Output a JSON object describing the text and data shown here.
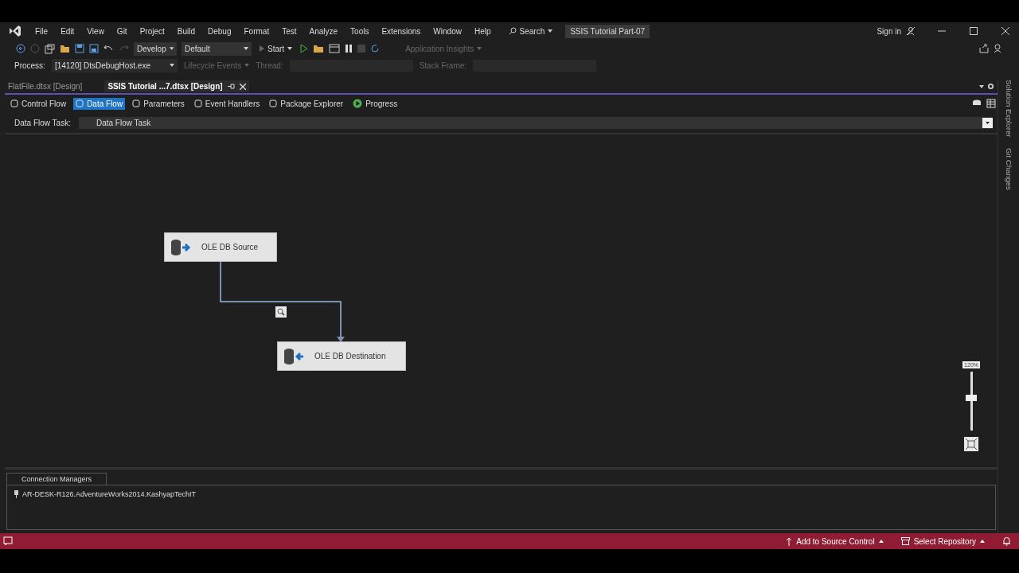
{
  "menu": {
    "items": [
      "File",
      "Edit",
      "View",
      "Git",
      "Project",
      "Build",
      "Debug",
      "Format",
      "Test",
      "Analyze",
      "Tools",
      "Extensions",
      "Window",
      "Help"
    ],
    "search": "Search",
    "solution_title": "SSIS Tutorial Part-07",
    "sign_in": "Sign in"
  },
  "toolbar": {
    "configuration": "Develop",
    "platform": "Default",
    "start": "Start",
    "insights": "Application Insights"
  },
  "debug_bar": {
    "process_label": "Process:",
    "process": "[14120] DtsDebugHost.exe",
    "lifecycle": "Lifecycle Events",
    "thread_label": "Thread:",
    "stack_frame_label": "Stack Frame:"
  },
  "document_tabs": [
    {
      "label": "FlatFile.dtsx [Design]",
      "selected": false
    },
    {
      "label": "SSIS Tutorial ...7.dtsx [Design]",
      "selected": true
    }
  ],
  "designer_tabs": [
    {
      "label": "Control Flow",
      "selected": false
    },
    {
      "label": "Data Flow",
      "selected": true
    },
    {
      "label": "Parameters",
      "selected": false
    },
    {
      "label": "Event Handlers",
      "selected": false
    },
    {
      "label": "Package Explorer",
      "selected": false
    },
    {
      "label": "Progress",
      "selected": false
    }
  ],
  "task_selector": {
    "label": "Data Flow Task:",
    "value": "Data Flow Task"
  },
  "nodes": [
    {
      "label": "OLE DB Source",
      "kind": "source"
    },
    {
      "label": "OLE DB Destination",
      "kind": "destination"
    }
  ],
  "zoom": {
    "reading": "120%",
    "level": 0.56
  },
  "side_rail": [
    "Solution Explorer",
    "Git Changes"
  ],
  "connection_managers": {
    "title": "Connection Managers",
    "items": [
      "AR-DESK-R126.AdventureWorks2014.KashyapTechIT"
    ]
  },
  "status_bar": {
    "items": [
      "Add to Source Control",
      "Select Repository"
    ]
  }
}
